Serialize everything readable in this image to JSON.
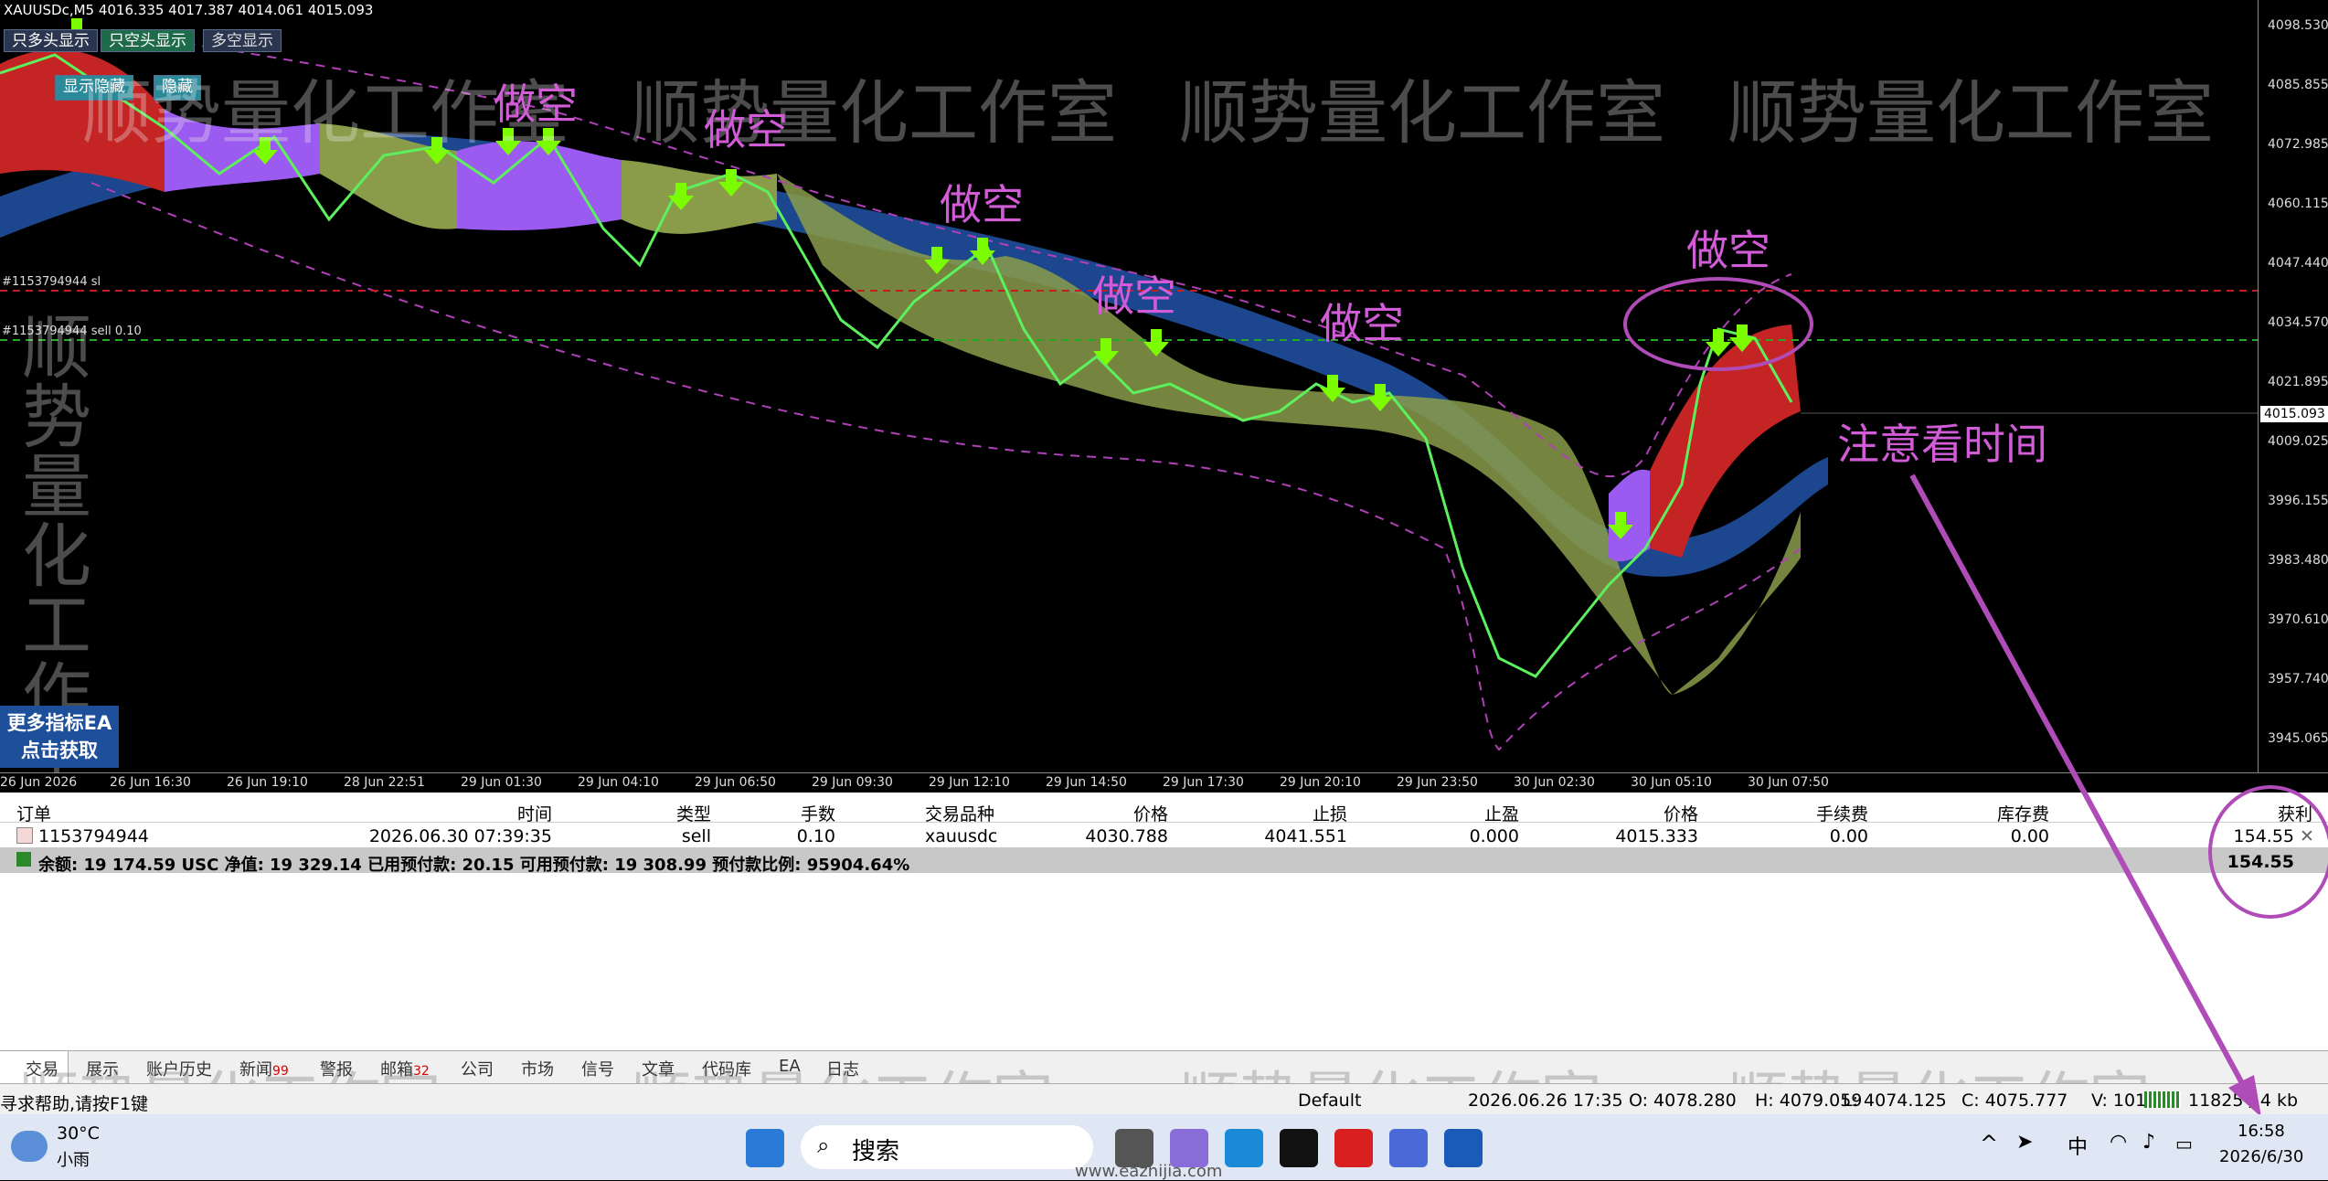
{
  "chart": {
    "header": "XAUUSDc,M5  4016.335 4017.387 4014.061 4015.093",
    "buttons": [
      "只多头显示",
      "只空头显示",
      "多空显示"
    ],
    "buttons2": [
      "显示隐藏",
      "隐藏"
    ],
    "y_ticks": [
      "4098.530",
      "4085.855",
      "4072.985",
      "4060.115",
      "4047.440",
      "4034.570",
      "4021.895",
      "4009.025",
      "3996.155",
      "3983.480",
      "3970.610",
      "3957.740",
      "3945.065"
    ],
    "current_price": "4015.093",
    "x_ticks": [
      "26 Jun 2026",
      "26 Jun 16:30",
      "26 Jun 19:10",
      "28 Jun 22:51",
      "29 Jun 01:30",
      "29 Jun 04:10",
      "29 Jun 06:50",
      "29 Jun 09:30",
      "29 Jun 12:10",
      "29 Jun 14:50",
      "29 Jun 17:30",
      "29 Jun 20:10",
      "29 Jun 23:50",
      "30 Jun 02:30",
      "30 Jun 05:10",
      "30 Jun 07:50"
    ],
    "sl_label": "#1153794944 sl",
    "sell_label": "#1153794944 sell 0.10",
    "annotations": [
      "做空",
      "做空",
      "做空",
      "做空",
      "做空",
      "做空"
    ],
    "note": "注意看时间",
    "watermark": "顺势量化工作室",
    "ea_button": [
      "更多指标EA",
      "点击获取"
    ],
    "colors": {
      "bull_band": "#8a9c4a",
      "bear_band": "#c42424",
      "purple_band": "#9c5bf0",
      "blue_band": "#1f4e9c",
      "arrow": "#7cfc00",
      "annotation": "#d25bd8"
    }
  },
  "terminal": {
    "headers": [
      "订单",
      "时间",
      "类型",
      "手数",
      "交易品种",
      "价格",
      "止损",
      "止盈",
      "价格",
      "手续费",
      "库存费",
      "获利"
    ],
    "row": [
      "1153794944",
      "2026.06.30 07:39:35",
      "sell",
      "0.10",
      "xauusdc",
      "4030.788",
      "4041.551",
      "0.000",
      "4015.333",
      "0.00",
      "0.00",
      "154.55"
    ],
    "total_text": "余额: 19 174.59 USC  净值: 19 329.14  已用预付款: 20.15  可用预付款: 19 308.99  预付款比例: 95904.64%",
    "total_profit": "154.55",
    "tabs": [
      "交易",
      "展示",
      "账户历史",
      "新闻",
      "警报",
      "邮箱",
      "公司",
      "市场",
      "信号",
      "文章",
      "代码库",
      "EA",
      "日志"
    ],
    "news_badge": "99",
    "mail_badge": "32"
  },
  "statusbar": {
    "help": "寻求帮助,请按F1键",
    "profile": "Default",
    "datetime": "2026.06.26 17:35",
    "open": "O: 4078.280",
    "high": "H: 4079.059",
    "low": "L: 4074.125",
    "close": "C: 4075.777",
    "volume": "V: 1017",
    "traffic": "11825 / 4 kb"
  },
  "taskbar": {
    "weather_temp": "30°C",
    "weather_desc": "小雨",
    "search": "搜索",
    "ime": "中",
    "time": "16:58",
    "date": "2026/6/30",
    "site": "www.eazhijia.com"
  }
}
